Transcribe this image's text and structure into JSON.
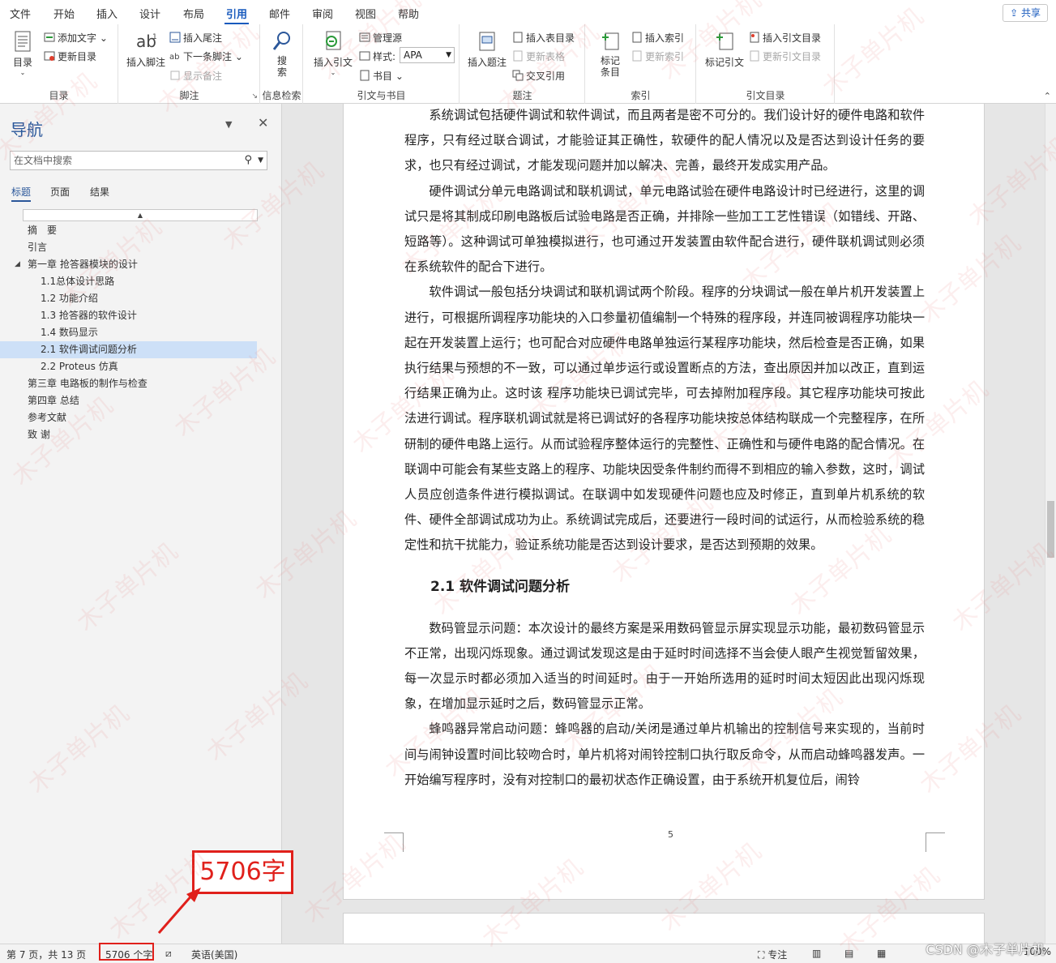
{
  "menu": {
    "tabs": [
      "文件",
      "开始",
      "插入",
      "设计",
      "布局",
      "引用",
      "邮件",
      "审阅",
      "视图",
      "帮助"
    ],
    "active": "引用",
    "share": "共享"
  },
  "ribbon": {
    "toc": {
      "big": "目录",
      "add_text": "添加文字",
      "update_toc": "更新目录",
      "label": "目录"
    },
    "footnotes": {
      "insert_footnote": "插入脚注",
      "insert_endnote": "插入尾注",
      "next_footnote": "下一条脚注",
      "show_notes": "显示备注",
      "label": "脚注"
    },
    "research": {
      "search": "搜索",
      "label": "信息检索"
    },
    "citations": {
      "insert_citation": "插入引文",
      "manage_sources": "管理源",
      "style_label": "样式:",
      "style_value": "APA",
      "bibliography": "书目",
      "label": "引文与书目"
    },
    "captions": {
      "insert_caption": "插入题注",
      "insert_tof": "插入表目录",
      "update_table": "更新表格",
      "cross_ref": "交叉引用",
      "label": "题注"
    },
    "index": {
      "mark_entry": "标记条目",
      "insert_index": "插入索引",
      "update_index": "更新索引",
      "label": "索引"
    },
    "toa": {
      "mark_citation": "标记引文",
      "insert_toa": "插入引文目录",
      "update_toa": "更新引文目录",
      "label": "引文目录"
    }
  },
  "nav": {
    "title": "导航",
    "search_placeholder": "在文档中搜索",
    "tabs": [
      "标题",
      "页面",
      "结果"
    ],
    "items": [
      {
        "text": "摘　要",
        "level": 1
      },
      {
        "text": "引言",
        "level": 1
      },
      {
        "text": "第一章  抢答器模块的设计",
        "level": 1,
        "expanded": true
      },
      {
        "text": "1.1总体设计思路",
        "level": 2
      },
      {
        "text": "1.2 功能介绍",
        "level": 2
      },
      {
        "text": "1.3 抢答器的软件设计",
        "level": 2
      },
      {
        "text": "1.4 数码显示",
        "level": 2
      },
      {
        "text": "2.1  软件调试问题分析",
        "level": 2,
        "selected": true
      },
      {
        "text": "2.2 Proteus 仿真",
        "level": 2
      },
      {
        "text": "第三章 电路板的制作与检查",
        "level": 1
      },
      {
        "text": "第四章 总结",
        "level": 1
      },
      {
        "text": "参考文献",
        "level": 1
      },
      {
        "text": "致  谢",
        "level": 1
      }
    ]
  },
  "document": {
    "para1": "系统调试包括硬件调试和软件调试，而且两者是密不可分的。我们设计好的硬件电路和软件程序，只有经过联合调试，才能验证其正确性，软硬件的配人情况以及是否达到设计任务的要求，也只有经过调试，才能发现问题并加以解决、完善，最终开发成实用产品。",
    "para2": "硬件调试分单元电路调试和联机调试，单元电路试验在硬件电路设计时已经进行，这里的调试只是将其制成印刷电路板后试验电路是否正确，并排除一些加工工艺性错误（如错线、开路、短路等）。这种调试可单独模拟进行，也可通过开发装置由软件配合进行，硬件联机调试则必须在系统软件的配合下进行。",
    "para3": "软件调试一般包括分块调试和联机调试两个阶段。程序的分块调试一般在单片机开发装置上进行，可根据所调程序功能块的入口参量初值编制一个特殊的程序段，并连同被调程序功能块一起在开发装置上运行；也可配合对应硬件电路单独运行某程序功能块，然后检查是否正确，如果执行结果与预想的不一致，可以通过单步运行或设置断点的方法，查出原因并加以改正，直到运行结果正确为止。这时该 程序功能块已调试完毕，可去掉附加程序段。其它程序功能块可按此法进行调试。程序联机调试就是将已调试好的各程序功能块按总体结构联成一个完整程序，在所研制的硬件电路上运行。从而试验程序整体运行的完整性、正确性和与硬件电路的配合情况。在联调中可能会有某些支路上的程序、功能块因受条件制约而得不到相应的输入参数，这时，调试人员应创造条件进行模拟调试。在联调中如发现硬件问题也应及时修正，直到单片机系统的软件、硬件全部调试成功为止。系统调试完成后，还要进行一段时间的试运行，从而检验系统的稳定性和抗干扰能力，验证系统功能是否达到设计要求，是否达到预期的效果。",
    "heading": "2.1  软件调试问题分析",
    "para4": "数码管显示问题：本次设计的最终方案是采用数码管显示屏实现显示功能，最初数码管显示不正常，出现闪烁现象。通过调试发现这是由于延时时间选择不当会使人眼产生视觉暂留效果，每一次显示时都必须加入适当的时间延时。由于一开始所选用的延时时间太短因此出现闪烁现象，在增加显示延时之后，数码管显示正常。",
    "para5": "蜂鸣器异常启动问题：蜂鸣器的启动/关闭是通过单片机输出的控制信号来实现的，当前时间与闹钟设置时间比较吻合时，单片机将对闹铃控制口执行取反命令，从而启动蜂鸣器发声。一开始编写程序时，没有对控制口的最初状态作正确设置，由于系统开机复位后，闹铃",
    "page_number": "5"
  },
  "status": {
    "page": "第 7 页，共 13 页",
    "words": "5706 个字",
    "language": "英语(美国)",
    "focus": "专注",
    "zoom": "100%"
  },
  "annotation": {
    "callout": "5706字"
  },
  "watermark": {
    "text": "木子单片机",
    "csdn": "CSDN @木子单片机"
  },
  "colors": {
    "accent": "#185abd",
    "annotation_red": "#e0201b",
    "nav_selected": "#cde0f7"
  }
}
